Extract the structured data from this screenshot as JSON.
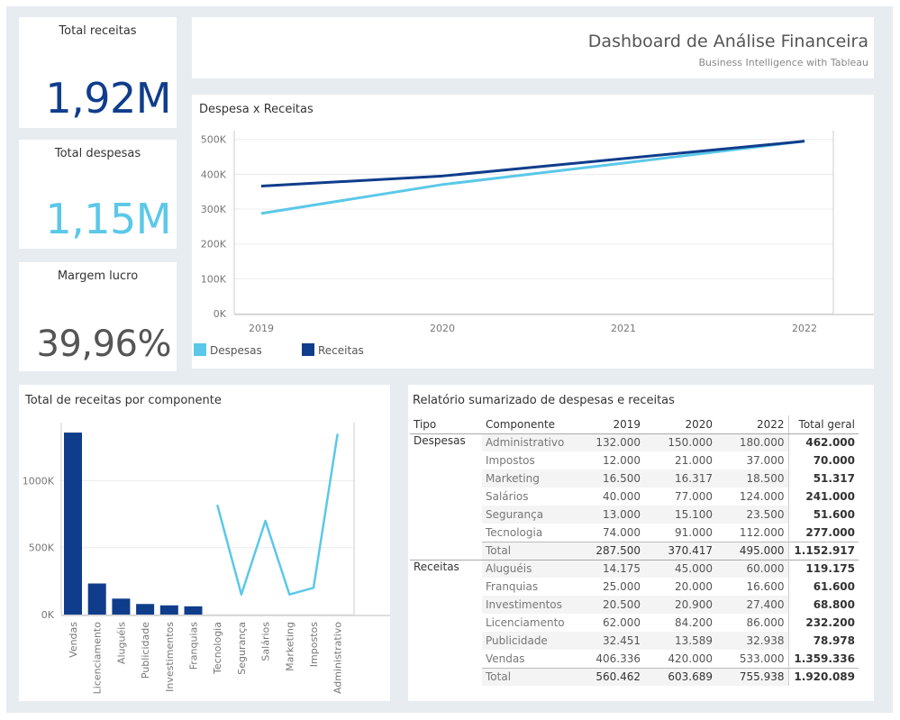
{
  "kpis": {
    "receitas": {
      "title": "Total receitas",
      "value": "1,92M",
      "color": "#0f3d8c"
    },
    "despesas": {
      "title": "Total despesas",
      "value": "1,15M",
      "color": "#5bc8e8"
    },
    "margem": {
      "title": "Margem lucro",
      "value": "39,96%",
      "color": "#555555"
    }
  },
  "header": {
    "title": "Dashboard de Análise Financeira",
    "subtitle": "Business Intelligence with Tableau"
  },
  "line_panel": {
    "title": "Despesa x Receitas",
    "legend": [
      {
        "label": "Despesas",
        "color": "#5bc8e8"
      },
      {
        "label": "Receitas",
        "color": "#0f3d8c"
      }
    ]
  },
  "bar_panel": {
    "title": "Total de receitas por componente"
  },
  "report": {
    "title": "Relatório sumarizado de despesas e receitas",
    "headers": [
      "Tipo",
      "Componente",
      "2019",
      "2020",
      "2022",
      "Total geral"
    ],
    "groups": [
      {
        "tipo": "Despesas",
        "rows": [
          [
            "Administrativo",
            "132.000",
            "150.000",
            "180.000",
            "462.000"
          ],
          [
            "Impostos",
            "12.000",
            "21.000",
            "37.000",
            "70.000"
          ],
          [
            "Marketing",
            "16.500",
            "16.317",
            "18.500",
            "51.317"
          ],
          [
            "Salários",
            "40.000",
            "77.000",
            "124.000",
            "241.000"
          ],
          [
            "Segurança",
            "13.000",
            "15.100",
            "23.500",
            "51.600"
          ],
          [
            "Tecnologia",
            "74.000",
            "91.000",
            "112.000",
            "277.000"
          ]
        ],
        "total": [
          "Total",
          "287.500",
          "370.417",
          "495.000",
          "1.152.917"
        ]
      },
      {
        "tipo": "Receitas",
        "rows": [
          [
            "Aluguéis",
            "14.175",
            "45.000",
            "60.000",
            "119.175"
          ],
          [
            "Franquias",
            "25.000",
            "20.000",
            "16.600",
            "61.600"
          ],
          [
            "Investimentos",
            "20.500",
            "20.900",
            "27.400",
            "68.800"
          ],
          [
            "Licenciamento",
            "62.000",
            "84.200",
            "86.000",
            "232.200"
          ],
          [
            "Publicidade",
            "32.451",
            "13.589",
            "32.938",
            "78.978"
          ],
          [
            "Vendas",
            "406.336",
            "420.000",
            "533.000",
            "1.359.336"
          ]
        ],
        "total": [
          "Total",
          "560.462",
          "603.689",
          "755.938",
          "1.920.089"
        ]
      }
    ]
  },
  "chart_data": [
    {
      "type": "line",
      "title": "Despesa x Receitas",
      "x": [
        "2019",
        "2020",
        "2021",
        "2022"
      ],
      "ylim": [
        0,
        520000
      ],
      "yticks": [
        "0K",
        "100K",
        "200K",
        "300K",
        "400K",
        "500K"
      ],
      "series": [
        {
          "name": "Despesas",
          "color": "#5bc8e8",
          "values": [
            287500,
            370417,
            432000,
            495000
          ]
        },
        {
          "name": "Receitas",
          "color": "#0f3d8c",
          "values": [
            366000,
            395000,
            445000,
            495000
          ]
        }
      ],
      "legend": "bottom-left",
      "grid": true
    },
    {
      "type": "bar",
      "title": "Total de receitas por componente",
      "yticks": [
        "0K",
        "500K",
        "1000K"
      ],
      "ylim": [
        0,
        1400000
      ],
      "bars": {
        "color": "#0f3d8c",
        "categories": [
          "Vendas",
          "Licenciamento",
          "Aluguéis",
          "Publicidade",
          "Investimentos",
          "Franquias"
        ],
        "values": [
          1359336,
          232200,
          119175,
          78978,
          68800,
          61600
        ]
      },
      "line": {
        "color": "#5bc8e8",
        "categories": [
          "Tecnologia",
          "Segurança",
          "Salários",
          "Marketing",
          "Impostos",
          "Administrativo"
        ],
        "values": [
          820000,
          150000,
          700000,
          150000,
          200000,
          1350000
        ]
      },
      "grid": true
    }
  ]
}
